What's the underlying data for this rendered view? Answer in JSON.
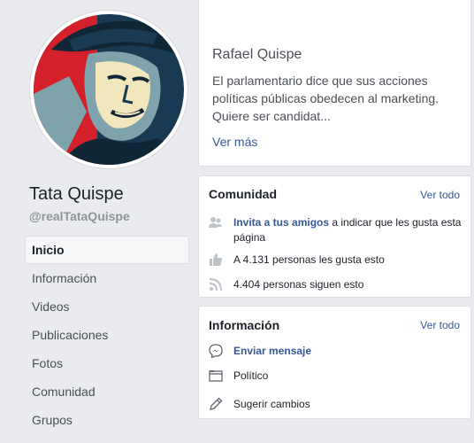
{
  "profile": {
    "name": "Tata Quispe",
    "handle": "@realTataQuispe"
  },
  "nav": {
    "items": [
      {
        "label": "Inicio",
        "active": true
      },
      {
        "label": "Información"
      },
      {
        "label": "Videos"
      },
      {
        "label": "Publicaciones"
      },
      {
        "label": "Fotos"
      },
      {
        "label": "Comunidad"
      },
      {
        "label": "Grupos"
      }
    ]
  },
  "about": {
    "name": "Rafael Quispe",
    "description": "El parlamentario dice que sus acciones políticas públicas obedecen al marketing. Quiere ser candidat...",
    "more_label": "Ver más"
  },
  "community": {
    "title": "Comunidad",
    "see_all": "Ver todo",
    "invite_link": "Invita a tus amigos",
    "invite_rest": " a indicar que les gusta esta página",
    "likes": "A 4.131 personas les gusta esto",
    "follows": "4.404 personas siguen esto"
  },
  "info": {
    "title": "Información",
    "see_all": "Ver todo",
    "message": "Enviar mensaje",
    "category": "Político",
    "suggest": "Sugerir cambios"
  },
  "colors": {
    "link": "#365899",
    "poster_red": "#d3202a",
    "poster_navy": "#183a52",
    "poster_cream": "#f2e6bd",
    "poster_blue": "#7fa3ad"
  },
  "icons": {
    "invite": "add-friends-icon",
    "likes": "thumbs-up-icon",
    "follows": "rss-icon",
    "message": "messenger-icon",
    "category": "folder-icon",
    "suggest": "pencil-icon"
  }
}
